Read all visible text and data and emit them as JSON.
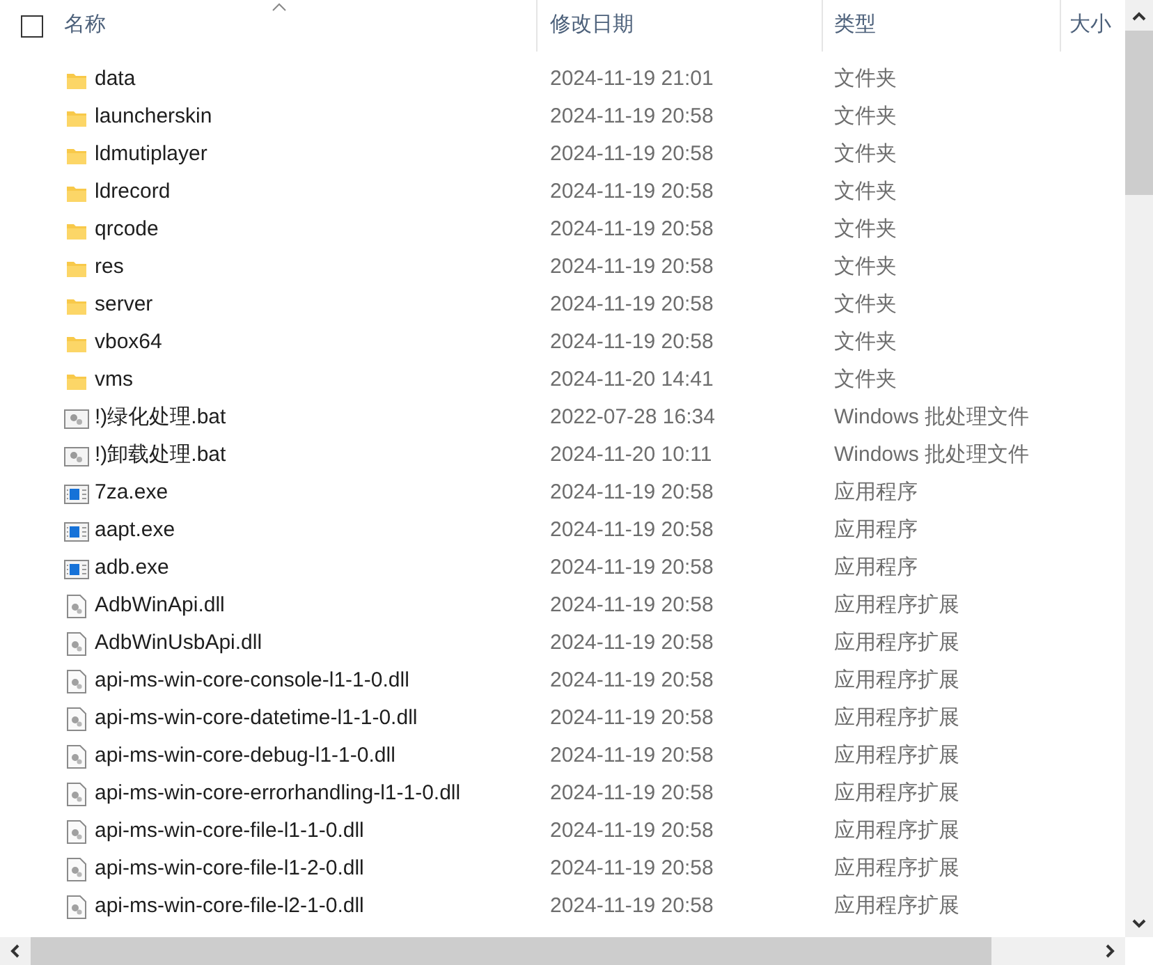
{
  "select_all": {
    "checked": false
  },
  "columns": {
    "name": "名称",
    "modified": "修改日期",
    "type": "类型",
    "size": "大小"
  },
  "files": [
    {
      "kind": "folder",
      "name": "data",
      "modified": "2024-11-19 21:01",
      "type": "文件夹"
    },
    {
      "kind": "folder",
      "name": "launcherskin",
      "modified": "2024-11-19 20:58",
      "type": "文件夹"
    },
    {
      "kind": "folder",
      "name": "ldmutiplayer",
      "modified": "2024-11-19 20:58",
      "type": "文件夹"
    },
    {
      "kind": "folder",
      "name": "ldrecord",
      "modified": "2024-11-19 20:58",
      "type": "文件夹"
    },
    {
      "kind": "folder",
      "name": "qrcode",
      "modified": "2024-11-19 20:58",
      "type": "文件夹"
    },
    {
      "kind": "folder",
      "name": "res",
      "modified": "2024-11-19 20:58",
      "type": "文件夹"
    },
    {
      "kind": "folder",
      "name": "server",
      "modified": "2024-11-19 20:58",
      "type": "文件夹"
    },
    {
      "kind": "folder",
      "name": "vbox64",
      "modified": "2024-11-19 20:58",
      "type": "文件夹"
    },
    {
      "kind": "folder",
      "name": "vms",
      "modified": "2024-11-20 14:41",
      "type": "文件夹"
    },
    {
      "kind": "batch",
      "name": "!)绿化处理.bat",
      "modified": "2022-07-28 16:34",
      "type": "Windows 批处理文件"
    },
    {
      "kind": "batch",
      "name": "!)卸载处理.bat",
      "modified": "2024-11-20 10:11",
      "type": "Windows 批处理文件"
    },
    {
      "kind": "exe",
      "name": "7za.exe",
      "modified": "2024-11-19 20:58",
      "type": "应用程序"
    },
    {
      "kind": "exe",
      "name": "aapt.exe",
      "modified": "2024-11-19 20:58",
      "type": "应用程序"
    },
    {
      "kind": "exe",
      "name": "adb.exe",
      "modified": "2024-11-19 20:58",
      "type": "应用程序"
    },
    {
      "kind": "dll",
      "name": "AdbWinApi.dll",
      "modified": "2024-11-19 20:58",
      "type": "应用程序扩展"
    },
    {
      "kind": "dll",
      "name": "AdbWinUsbApi.dll",
      "modified": "2024-11-19 20:58",
      "type": "应用程序扩展"
    },
    {
      "kind": "dll",
      "name": "api-ms-win-core-console-l1-1-0.dll",
      "modified": "2024-11-19 20:58",
      "type": "应用程序扩展"
    },
    {
      "kind": "dll",
      "name": "api-ms-win-core-datetime-l1-1-0.dll",
      "modified": "2024-11-19 20:58",
      "type": "应用程序扩展"
    },
    {
      "kind": "dll",
      "name": "api-ms-win-core-debug-l1-1-0.dll",
      "modified": "2024-11-19 20:58",
      "type": "应用程序扩展"
    },
    {
      "kind": "dll",
      "name": "api-ms-win-core-errorhandling-l1-1-0.dll",
      "modified": "2024-11-19 20:58",
      "type": "应用程序扩展"
    },
    {
      "kind": "dll",
      "name": "api-ms-win-core-file-l1-1-0.dll",
      "modified": "2024-11-19 20:58",
      "type": "应用程序扩展"
    },
    {
      "kind": "dll",
      "name": "api-ms-win-core-file-l1-2-0.dll",
      "modified": "2024-11-19 20:58",
      "type": "应用程序扩展"
    },
    {
      "kind": "dll",
      "name": "api-ms-win-core-file-l2-1-0.dll",
      "modified": "2024-11-19 20:58",
      "type": "应用程序扩展"
    }
  ]
}
